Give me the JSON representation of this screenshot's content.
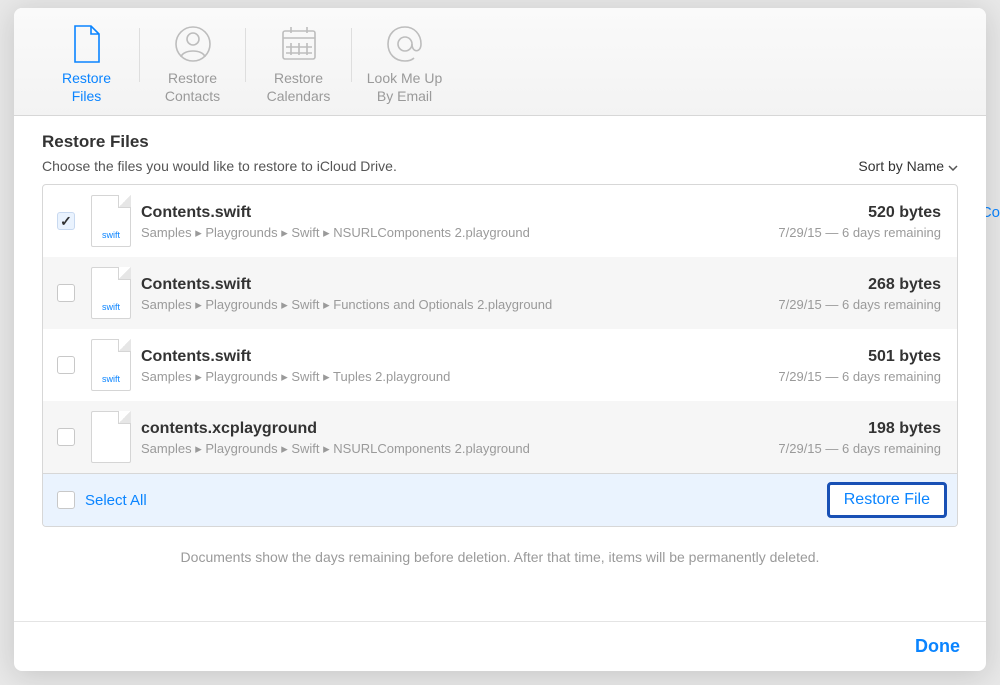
{
  "toolbar": {
    "items": [
      {
        "label": "Restore\nFiles",
        "icon": "file-icon",
        "active": true
      },
      {
        "label": "Restore\nContacts",
        "icon": "contact-icon",
        "active": false
      },
      {
        "label": "Restore\nCalendars",
        "icon": "calendar-icon",
        "active": false
      },
      {
        "label": "Look Me Up\nBy Email",
        "icon": "at-icon",
        "active": false
      }
    ]
  },
  "page": {
    "title": "Restore Files",
    "subtitle": "Choose the files you would like to restore to iCloud Drive.",
    "sort_label": "Sort by Name"
  },
  "files": [
    {
      "checked": true,
      "ext": "swift",
      "name": "Contents.swift",
      "path": "Samples  ▸  Playgrounds  ▸  Swift  ▸  NSURLComponents 2.playground",
      "size": "520 bytes",
      "date": "7/29/15 — 6 days remaining"
    },
    {
      "checked": false,
      "ext": "swift",
      "name": "Contents.swift",
      "path": "Samples  ▸  Playgrounds  ▸  Swift  ▸  Functions and Optionals 2.playground",
      "size": "268 bytes",
      "date": "7/29/15 — 6 days remaining"
    },
    {
      "checked": false,
      "ext": "swift",
      "name": "Contents.swift",
      "path": "Samples  ▸  Playgrounds  ▸  Swift  ▸  Tuples 2.playground",
      "size": "501 bytes",
      "date": "7/29/15 — 6 days remaining"
    },
    {
      "checked": false,
      "ext": "",
      "name": "contents.xcplayground",
      "path": "Samples  ▸  Playgrounds  ▸  Swift  ▸  NSURLComponents 2.playground",
      "size": "198 bytes",
      "date": "7/29/15 — 6 days remaining"
    }
  ],
  "list_footer": {
    "select_all": "Select All",
    "restore_button": "Restore File"
  },
  "note": "Documents show the days remaining before deletion. After that time, items will be permanently deleted.",
  "footer": {
    "done": "Done"
  },
  "background_peek": "Co"
}
